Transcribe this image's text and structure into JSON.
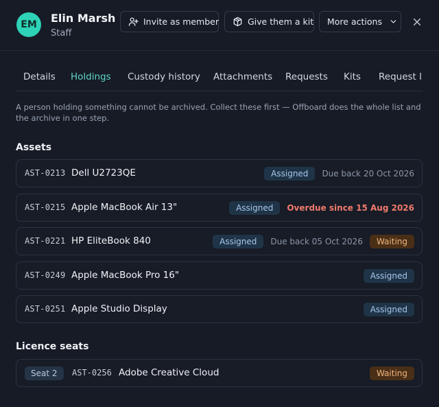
{
  "person": {
    "initials": "EM",
    "name": "Elin Marsh",
    "role": "Staff"
  },
  "header": {
    "invite_label": "Invite as member",
    "kit_label": "Give them a kit",
    "more_label": "More actions"
  },
  "tabs": [
    {
      "label": "Details"
    },
    {
      "label": "Holdings",
      "active": true
    },
    {
      "label": "Custody history"
    },
    {
      "label": "Attachments"
    },
    {
      "label": "Requests"
    },
    {
      "label": "Kits"
    },
    {
      "label": "Request lin"
    }
  ],
  "notice": "A person holding something cannot be archived. Collect these first — Offboard does the whole list and the archive in one step.",
  "assets": {
    "title": "Assets",
    "rows": [
      {
        "code": "AST-0213",
        "name": "Dell U2723QE",
        "status": "Assigned",
        "due": "Due back 20 Oct 2026"
      },
      {
        "code": "AST-0215",
        "name": "Apple MacBook Air 13\"",
        "status": "Assigned",
        "overdue": "Overdue since 15 Aug 2026"
      },
      {
        "code": "AST-0221",
        "name": "HP EliteBook 840",
        "status": "Assigned",
        "due": "Due back 05 Oct 2026",
        "extra": "Waiting"
      },
      {
        "code": "AST-0249",
        "name": "Apple MacBook Pro 16\"",
        "status": "Assigned"
      },
      {
        "code": "AST-0251",
        "name": "Apple Studio Display",
        "status": "Assigned"
      }
    ]
  },
  "licence": {
    "title": "Licence seats",
    "rows": [
      {
        "seat": "Seat 2",
        "code": "AST-0256",
        "name": "Adobe Creative Cloud",
        "status": "Waiting"
      }
    ]
  },
  "colors": {
    "accent": "#2fc4b1",
    "overdue": "#f07a6c",
    "waiting": "#f1b57c",
    "assigned": "#a7c8ec"
  },
  "icons": {
    "invite": "user-plus-icon",
    "kit": "package-icon",
    "more": "chevron-down-icon",
    "close": "close-icon"
  }
}
